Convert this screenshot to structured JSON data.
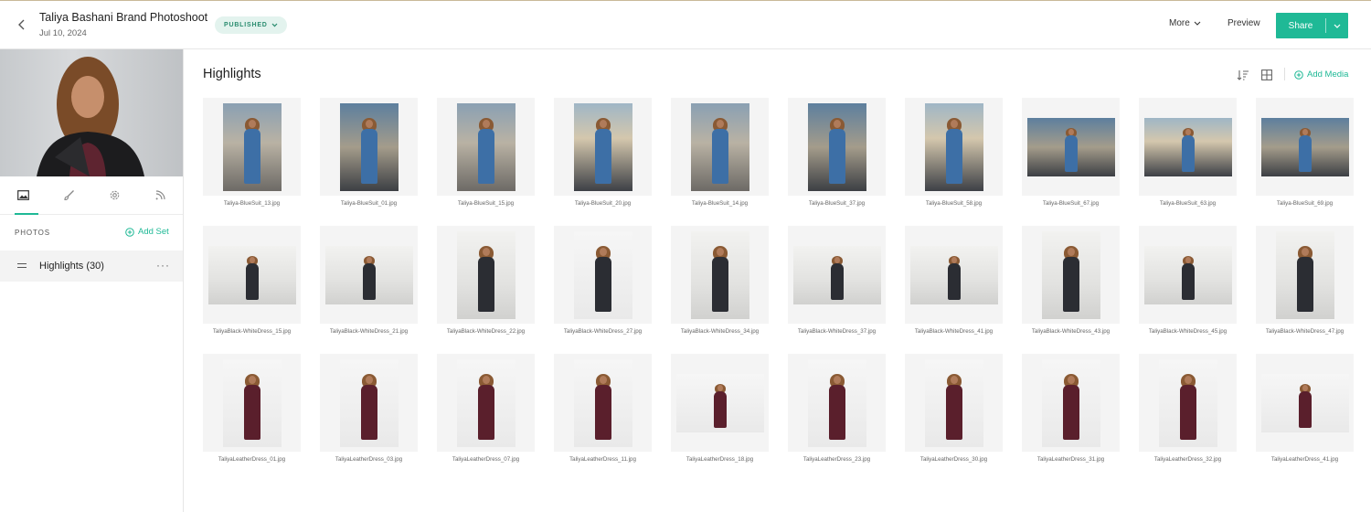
{
  "header": {
    "title": "Taliya Bashani Brand Photoshoot",
    "date": "Jul 10, 2024",
    "status_badge": "PUBLISHED",
    "more_label": "More",
    "preview_label": "Preview",
    "share_label": "Share"
  },
  "sidebar": {
    "tabs": [
      "photos-tab",
      "design-tab",
      "settings-tab",
      "activity-tab"
    ],
    "photos_label": "PHOTOS",
    "add_set_label": "Add Set",
    "sets": [
      {
        "label": "Highlights (30)"
      }
    ]
  },
  "main": {
    "title": "Highlights",
    "add_media_label": "Add Media",
    "photos": [
      "Taliya-BlueSuit_13.jpg",
      "Taliya-BlueSuit_01.jpg",
      "Taliya-BlueSuit_15.jpg",
      "Taliya-BlueSuit_20.jpg",
      "Taliya-BlueSuit_14.jpg",
      "Taliya-BlueSuit_37.jpg",
      "Taliya-BlueSuit_58.jpg",
      "Taliya-BlueSuit_67.jpg",
      "Taliya-BlueSuit_63.jpg",
      "Taliya-BlueSuit_69.jpg",
      "TaliyaBlack-WhiteDress_15.jpg",
      "TaliyaBlack-WhiteDress_21.jpg",
      "TaliyaBlack-WhiteDress_22.jpg",
      "TaliyaBlack-WhiteDress_27.jpg",
      "TaliyaBlack-WhiteDress_34.jpg",
      "TaliyaBlack-WhiteDress_37.jpg",
      "TaliyaBlack-WhiteDress_41.jpg",
      "TaliyaBlack-WhiteDress_43.jpg",
      "TaliyaBlack-WhiteDress_45.jpg",
      "TaliyaBlack-WhiteDress_47.jpg",
      "TaliyaLeatherDress_01.jpg",
      "TaliyaLeatherDress_03.jpg",
      "TaliyaLeatherDress_07.jpg",
      "TaliyaLeatherDress_11.jpg",
      "TaliyaLeatherDress_18.jpg",
      "TaliyaLeatherDress_23.jpg",
      "TaliyaLeatherDress_30.jpg",
      "TaliyaLeatherDress_31.jpg",
      "TaliyaLeatherDress_32.jpg",
      "TaliyaLeatherDress_41.jpg"
    ]
  },
  "colors": {
    "accent": "#1fb996",
    "badge_bg": "#e3f3ee",
    "badge_text": "#2a8c6f",
    "blue_suit": "#3d6fa6",
    "plaid_dress": "#2b2d33",
    "leather_dress": "#5a1f2c"
  },
  "icons": {
    "back": "chevron-left-icon",
    "badge_caret": "chevron-down-icon",
    "sort": "sort-icon",
    "grid": "grid-icon",
    "add": "plus-circle-icon",
    "set_handle": "drag-handle-icon",
    "set_menu": "more-dots-icon"
  }
}
